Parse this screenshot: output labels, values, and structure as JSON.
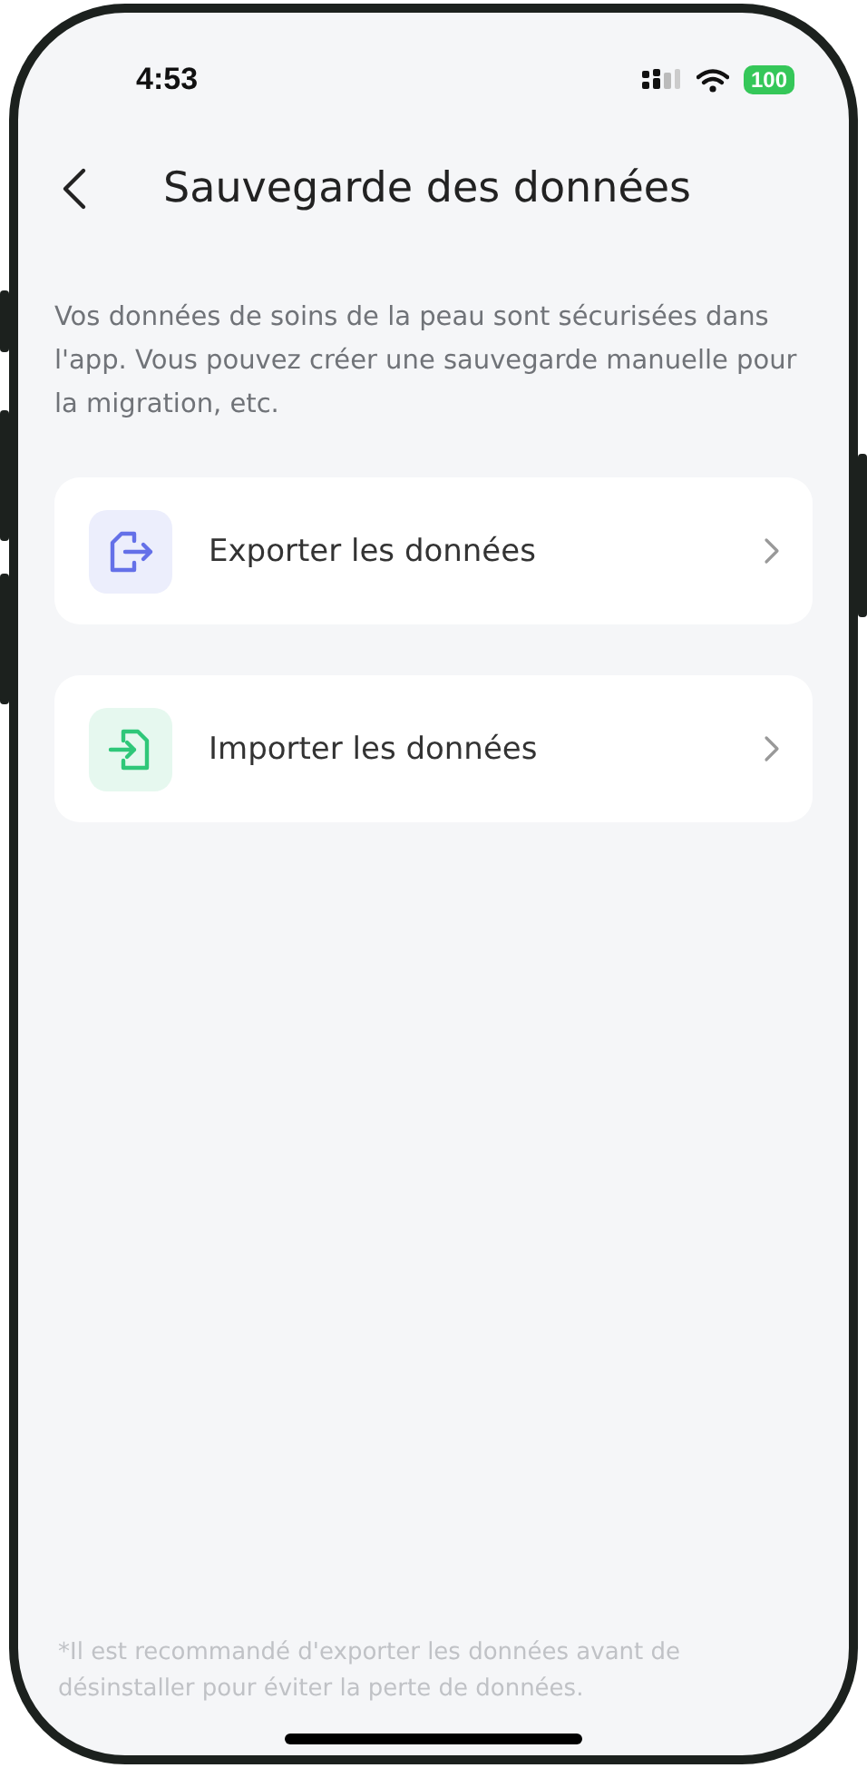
{
  "status_bar": {
    "time": "4:53",
    "battery": "100"
  },
  "header": {
    "title": "Sauvegarde des données"
  },
  "description": "Vos données de soins de la peau sont sécurisées dans l'app. Vous pouvez créer une sauvegarde manuelle pour la migration, etc.",
  "items": [
    {
      "kind": "export",
      "label": "Exporter les données"
    },
    {
      "kind": "import",
      "label": "Importer les données"
    }
  ],
  "footnote": "*Il est recommandé d'exporter les données avant de désinstaller pour éviter la perte de données."
}
